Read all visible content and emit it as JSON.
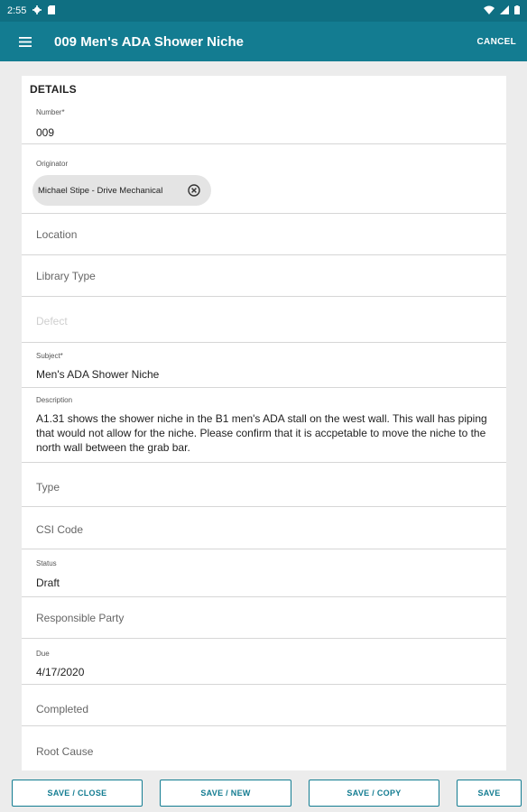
{
  "status_bar": {
    "time": "2:55",
    "icons": [
      "gear-icon",
      "sd-card-icon",
      "wifi-icon",
      "signal-icon",
      "battery-icon"
    ]
  },
  "app_bar": {
    "menu_icon": "hamburger-menu-icon",
    "title": "009 Men's ADA Shower Niche",
    "cancel_label": "CANCEL",
    "color": "#137c91"
  },
  "details": {
    "section_title": "DETAILS",
    "number": {
      "label": "Number*",
      "value": "009"
    },
    "originator": {
      "label": "Originator",
      "chip_text": "Michael Stipe - Drive Mechanical"
    },
    "location": {
      "placeholder": "Location"
    },
    "library_type": {
      "placeholder": "Library Type"
    },
    "defect": {
      "placeholder": "Defect"
    },
    "subject": {
      "label": "Subject*",
      "value": "Men's ADA Shower Niche"
    },
    "description": {
      "label": "Description",
      "value": "A1.31 shows the shower niche in the B1 men's ADA stall on the west wall. This wall has piping that would not allow for the niche. Please confirm that it is accpetable to move the niche to the north wall between the grab bar."
    },
    "type": {
      "placeholder": "Type"
    },
    "csi_code": {
      "placeholder": "CSI Code"
    },
    "status": {
      "label": "Status",
      "value": "Draft"
    },
    "responsible_party": {
      "placeholder": "Responsible Party"
    },
    "due": {
      "label": "Due",
      "value": "4/17/2020"
    },
    "completed": {
      "placeholder": "Completed"
    },
    "root_cause": {
      "placeholder": "Root Cause"
    }
  },
  "bottom_bar": {
    "save_close": "SAVE / CLOSE",
    "save_new": "SAVE / NEW",
    "save_copy": "SAVE / COPY",
    "save": "SAVE"
  }
}
